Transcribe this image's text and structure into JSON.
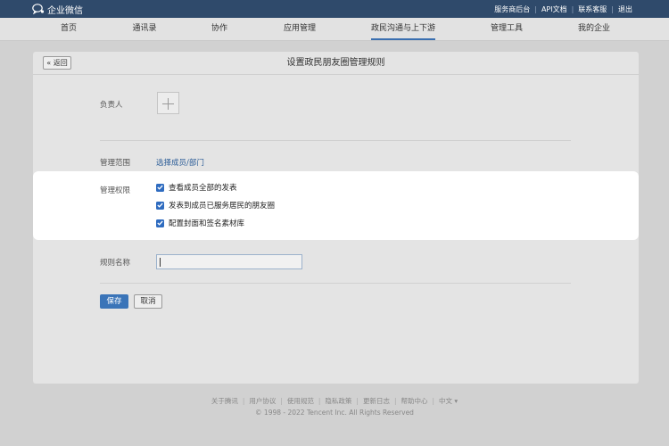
{
  "topbar": {
    "brand": "企业微信",
    "links": [
      "服务商后台",
      "API文档",
      "联系客服",
      "退出"
    ]
  },
  "nav": {
    "items": [
      "首页",
      "通讯录",
      "协作",
      "应用管理",
      "政民沟通与上下游",
      "管理工具",
      "我的企业"
    ],
    "active": "政民沟通与上下游"
  },
  "page": {
    "back_label": "« 返回",
    "title": "设置政民朋友圈管理规则"
  },
  "form": {
    "owner_label": "负责人",
    "scope_label": "管理范围",
    "scope_link": "选择成员/部门",
    "permissions_label": "管理权限",
    "permissions": [
      {
        "label": "查看成员全部的发表",
        "checked": true
      },
      {
        "label": "发表到成员已服务居民的朋友圈",
        "checked": true
      },
      {
        "label": "配置封面和签名素材库",
        "checked": true
      }
    ],
    "rule_name_label": "规则名称",
    "rule_name_value": "",
    "save_label": "保存",
    "cancel_label": "取消"
  },
  "footer": {
    "links": [
      "关于腾讯",
      "用户协议",
      "使用规范",
      "隐私政策",
      "更新日志",
      "帮助中心",
      "中文 ▾"
    ],
    "copyright": "© 1998 - 2022 Tencent Inc. All Rights Reserved"
  },
  "colors": {
    "topbar": "#2f4a6b",
    "accent": "#3a74b8",
    "link": "#2c5d97",
    "checkbox": "#2f6cc0"
  }
}
